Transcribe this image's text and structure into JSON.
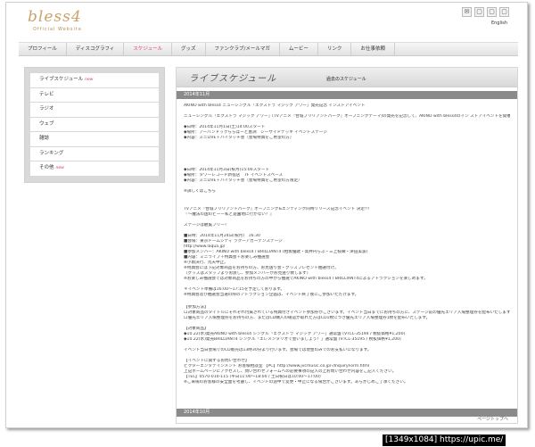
{
  "brand": {
    "logo_text": "bless4",
    "subtitle": "Official Website"
  },
  "top_icons": [
    "✉",
    "▢",
    "▢",
    "▢"
  ],
  "lang_label": "English",
  "nav": [
    {
      "label": "プロフィール",
      "active": false
    },
    {
      "label": "ディスコグラフィ",
      "active": false
    },
    {
      "label": "スケジュール",
      "active": true
    },
    {
      "label": "グッズ",
      "active": false
    },
    {
      "label": "ファンクラブ/メールマガ",
      "active": false
    },
    {
      "label": "ムービー",
      "active": false
    },
    {
      "label": "リンク",
      "active": false
    },
    {
      "label": "お仕事依頼",
      "active": false
    }
  ],
  "sidebar": [
    {
      "label": "ライブスケジュール",
      "badge": "new"
    },
    {
      "label": "テレビ",
      "badge": ""
    },
    {
      "label": "ラジオ",
      "badge": ""
    },
    {
      "label": "ウェブ",
      "badge": ""
    },
    {
      "label": "雑誌",
      "badge": ""
    },
    {
      "label": "ランキング",
      "badge": ""
    },
    {
      "label": "その他",
      "badge": "new"
    }
  ],
  "content": {
    "title": "ライブスケジュール",
    "past_link": "過去のスケジュール",
    "date_header_1": "2014年11月",
    "date_header_2": "2014年10月",
    "page_top": "ページトップへ",
    "lines_block1": [
      "AKINO with bless4 ニューシングル「エクストラ マジック アワー」発売記念 インストアイベント",
      "",
      "ニューシングル「エクストラ マジック アワー」(TVアニメ『甘城ブリリアントパーク』オープニングテーマ)の発売を記念して、AKINO with bless4のイン ストアイベントを開催いたします。観覧はフリーです。",
      "",
      "◆日時：2014年11月1日(土)14:00スタート",
      "◆場所：アーバンドックららぽーと豊洲　シーサイドデッキ イベントステージ",
      "◆内容：ミニLIVE＋ハイタッチ会（会場特典をご希望の方）"
    ],
    "lines_block2": [
      "◆日時：2014年11月3日(祝月)15:00スタート",
      "◆場所：タワーレコード新宿店　7F イベントスペース",
      "◆内容：ミニLIVE＋ハイタッチ会（会場特典をご希望の方限定）",
      "",
      "※詳しくはこちら"
    ],
    "lines_block3": [
      "TVアニメ『甘城ブリリアントパーク』オープニング&エンディング同時リリース記念イベント 決定!!!",
      "『〜魔法の国のビーー私と遊園地に行かない？』",
      "",
      "ステージは観覧フリー！",
      "",
      "■日時：2014年11月24日(祝月)　16:30",
      "■会場：東京ドームシティ ラクーアガーデンステージ",
      "http://www.laqua.jp/",
      "■参加メンバー：AKINO with bless4 / BRILLIANT4 (相坂優歌・高井円らぶ・三上枝織・津田美波)",
      "■内容：ミニライブ＋特典会＋お楽しみ抽選会",
      "※小雨決行、荒天中止。",
      "※特典会には下記対象商品をお持ちの方、お見送り会・グッズプレゼント抽選付け。",
      "（グッズはスタッフよりお渡し、参加メンバーがお見送り致します）",
      "※お楽しみ抽選会では対象商品をお持ちの方の中から抽選でAKINO with bless4 / BRILLIANT4によるアトラクションを楽しめます。",
      "",
      "＊イベント準備は16:00〜17:15を予定しております。",
      "※特典会及び抽選会当選の際のアトラクション企画は、イベント終了後にご参加いただけます。"
    ],
    "lines_block4": [
      "【参加方法】",
      "ロ対象商品のタイトルにそれぞれ付属されている特典付きイベント参加券がございます。イベント当日までにお持ちの方に、ステージ前の優先エリア入場整理券を配布いたします。",
      "ロ優先エリア入場整理券をお持ちの方、またはCD購入の確認が取れた方はCD1枚につき優先エリア入場整理券1枚を配布いたします。",
      "",
      "【対象商品】",
      "◆10.22(水)発売AKINO with bless4 シングル「エクストラ マジック アワー」通常盤 (VTCL-35194 / 税抜価格¥1,200)",
      "◆10.22(水)発売BRILLIANT4 シングル「エレメンタリオで会いましょう！」通常盤 (VTCL-35195 / 税抜価格¥1,200)",
      "",
      "イベント当日会場でのCD販売は13時30分より行います。会場では現金のみでのお支払いになります。",
      "",
      "【イベントに関するお問い合わせ】",
      "ビクターエンタテインメント お客様相談室 【PC】http://www.jvcmusic.co.jp/-/InquiryForm.html",
      "上記ホームページにアクセスし、問い合わせフォームへの必要事項の記入の上お問い合わせ内容をご記入ください。",
      "【TEL】0570-010-115 (平日11:00〜18:00 / 土日祝日は10:00〜17:00)",
      "※ご来場のお客様の安全面を考慮し、イベントの途中で変更・中止になる場合がございます。あらかじめご了承ください。"
    ]
  }
}
